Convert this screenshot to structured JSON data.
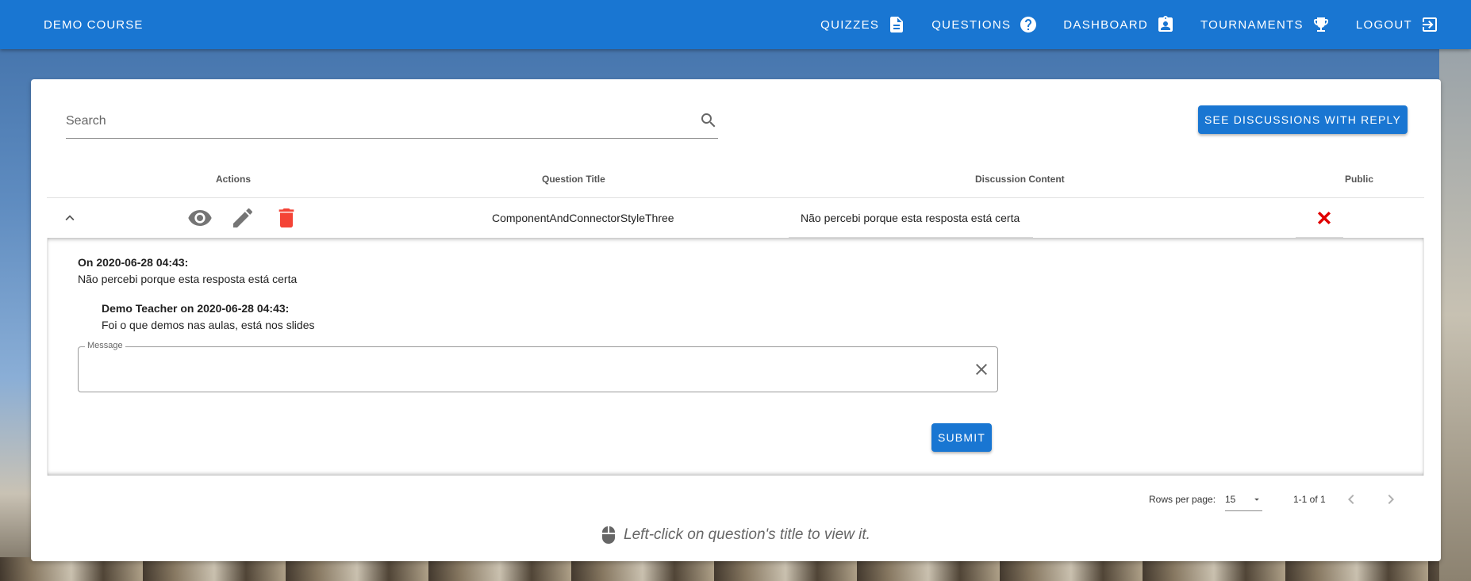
{
  "appbar": {
    "brand": "DEMO COURSE",
    "nav": [
      {
        "label": "QUIZZES",
        "icon": "file-document-icon"
      },
      {
        "label": "QUESTIONS",
        "icon": "question-circle-icon"
      },
      {
        "label": "DASHBOARD",
        "icon": "account-box-icon"
      },
      {
        "label": "TOURNAMENTS",
        "icon": "trophy-icon"
      },
      {
        "label": "LOGOUT",
        "icon": "logout-icon"
      }
    ],
    "color": "#1976d2"
  },
  "search": {
    "placeholder": "Search"
  },
  "toolbar": {
    "discussions_button": "SEE DISCUSSIONS WITH REPLY"
  },
  "table": {
    "headers": {
      "actions": "Actions",
      "question_title": "Question Title",
      "discussion_content": "Discussion Content",
      "public": "Public"
    },
    "rows": [
      {
        "question_title": "ComponentAndConnectorStyleThree",
        "discussion_content": "Não percebi porque esta resposta está certa",
        "public": false
      }
    ]
  },
  "expanded": {
    "discussion_date": "On 2020-06-28 04:43:",
    "discussion_text": "Não percebi porque esta resposta está certa",
    "reply_author": "Demo Teacher on 2020-06-28 04:43:",
    "reply_text": "Foi o que demos nas aulas, está nos slides",
    "message_label": "Message",
    "message_value": "",
    "submit_label": "SUBMIT"
  },
  "footer": {
    "rows_per_page_label": "Rows per page:",
    "rows_per_page_value": "15",
    "range": "1-1 of 1"
  },
  "hint": {
    "text": "Left-click on question's title to view it.",
    "icon": "mouse-icon"
  },
  "colors": {
    "accent": "#1976d2",
    "delete": "#f44336",
    "not_public": "#e00000"
  }
}
